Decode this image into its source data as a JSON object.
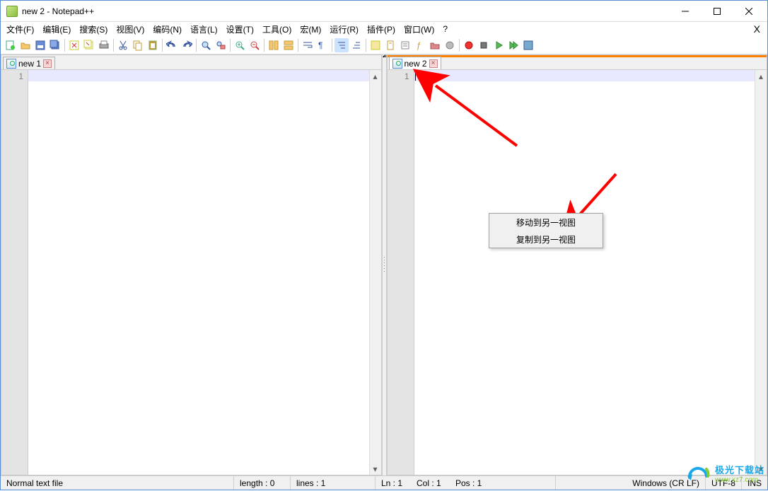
{
  "window": {
    "title": "new 2 - Notepad++"
  },
  "menu": {
    "items": [
      "文件(F)",
      "编辑(E)",
      "搜索(S)",
      "视图(V)",
      "编码(N)",
      "语言(L)",
      "设置(T)",
      "工具(O)",
      "宏(M)",
      "运行(R)",
      "插件(P)",
      "窗口(W)",
      "?"
    ],
    "right_x": "X"
  },
  "tabs": {
    "left": {
      "name": "new 1"
    },
    "right": {
      "name": "new 2"
    }
  },
  "gutter_line": "1",
  "context_menu": {
    "items": [
      "移动到另一视图",
      "复制到另一视图"
    ]
  },
  "status": {
    "filetype": "Normal text file",
    "length": "length : 0",
    "lines": "lines : 1",
    "ln": "Ln : 1",
    "col": "Col : 1",
    "pos": "Pos : 1",
    "eol": "Windows (CR LF)",
    "enc": "UTF-8",
    "ins": "INS"
  },
  "watermark": {
    "line1": "极光下载站",
    "line2": "www.xz7.com"
  }
}
